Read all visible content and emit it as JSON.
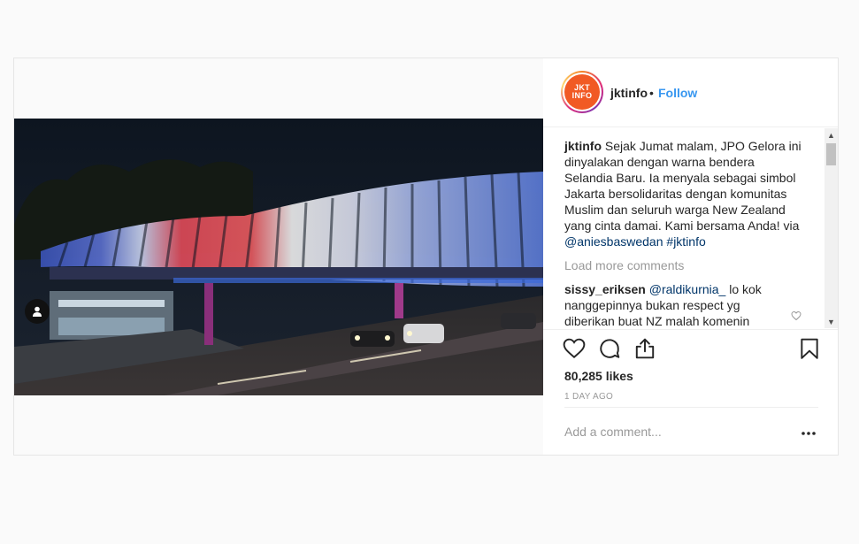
{
  "post": {
    "username": "jktinfo",
    "separator": "•",
    "follow_label": "Follow",
    "avatar_text_1": "JKT",
    "avatar_text_2": "INFO",
    "caption_user": "jktinfo",
    "caption_text": "Sejak Jumat malam, JPO Gelora ini dinyalakan dengan warna bendera Selandia Baru. Ia menyala sebagai simbol Jakarta bersolidaritas dengan komunitas Muslim dan seluruh warga New Zealand yang cinta damai. Kami bersama Anda! via ",
    "caption_mention": "@aniesbaswedan",
    "caption_space": " ",
    "caption_hashtag": "#jktinfo",
    "load_more": "Load more comments",
    "comments": [
      {
        "user": "sissy_eriksen",
        "mention": "@raldikurnia_",
        "text": " lo kok nanggepinnya bukan respect yg diberikan buat NZ malah komenin"
      }
    ],
    "likes": "80,285 likes",
    "time": "1 DAY AGO",
    "add_comment_placeholder": "Add a comment...",
    "icons": {
      "like": "heart-icon",
      "comment": "comment-icon",
      "share": "share-icon",
      "save": "bookmark-icon",
      "more": "more-options-icon",
      "user_tag": "user-tag-icon"
    },
    "colors": {
      "accent": "#3897f0",
      "avatar_bg": "#f15a24",
      "muted": "#999999"
    }
  }
}
